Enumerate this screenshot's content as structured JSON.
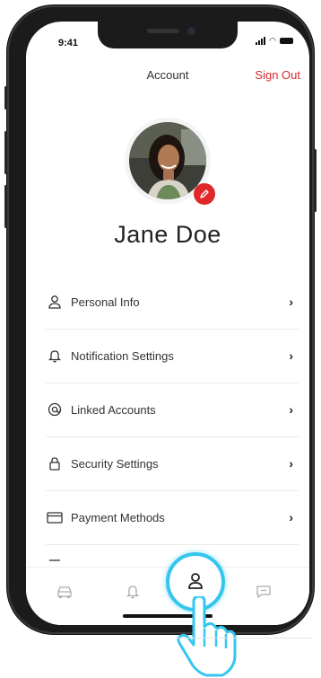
{
  "status": {
    "time": "9:41"
  },
  "header": {
    "title": "Account",
    "sign_out": "Sign Out"
  },
  "profile": {
    "name": "Jane Doe"
  },
  "menu": [
    {
      "label": "Personal Info",
      "icon": "person-icon"
    },
    {
      "label": "Notification Settings",
      "icon": "bell-icon"
    },
    {
      "label": "Linked Accounts",
      "icon": "at-icon"
    },
    {
      "label": "Security Settings",
      "icon": "lock-icon"
    },
    {
      "label": "Payment Methods",
      "icon": "credit-card-icon"
    }
  ],
  "tabs": [
    {
      "icon": "car-icon"
    },
    {
      "icon": "bell-icon"
    },
    {
      "icon": "person-icon",
      "active": true
    },
    {
      "icon": "chat-icon"
    }
  ],
  "colors": {
    "accent": "#d8282a",
    "highlight_ring": "#35c6ef"
  }
}
